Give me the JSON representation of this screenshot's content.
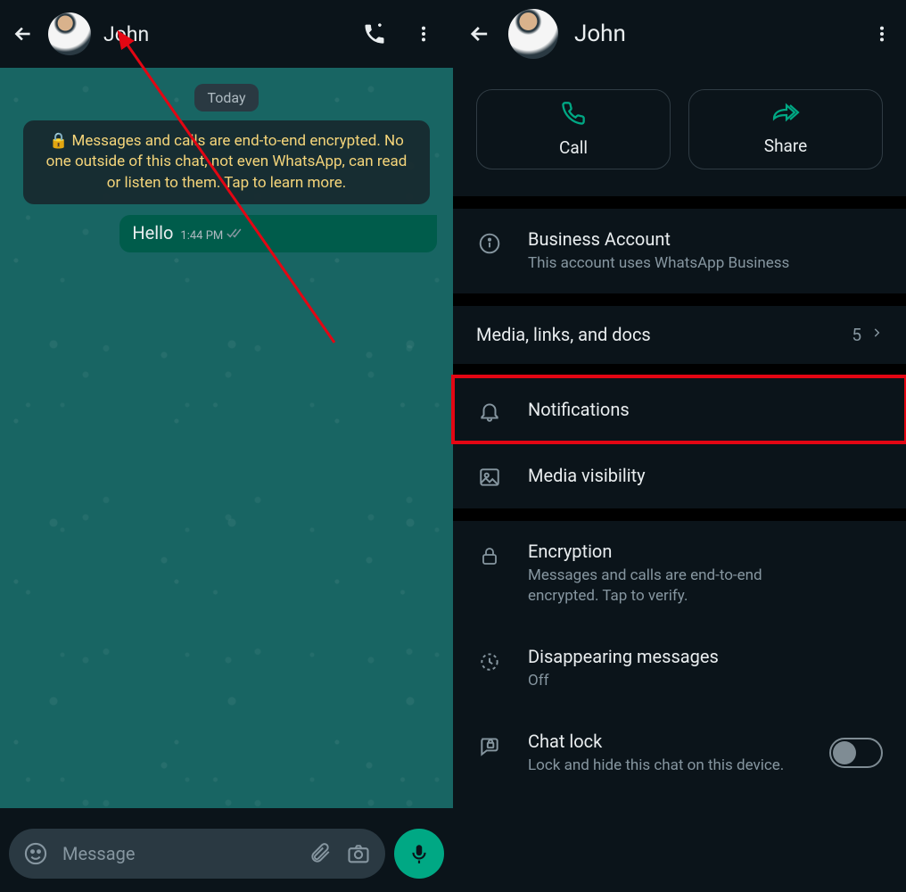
{
  "left": {
    "contact_name": "John",
    "date_label": "Today",
    "encryption_notice": "🔒 Messages and calls are end-to-end encrypted. No one outside of this chat, not even WhatsApp, can read or listen to them. Tap to learn more.",
    "message": {
      "text": "Hello",
      "time": "1:44 PM"
    },
    "input_placeholder": "Message"
  },
  "right": {
    "contact_name": "John",
    "call_label": "Call",
    "share_label": "Share",
    "business": {
      "title": "Business Account",
      "subtitle": "This account uses WhatsApp Business"
    },
    "media": {
      "title": "Media, links, and docs",
      "count": "5"
    },
    "notifications": {
      "title": "Notifications"
    },
    "media_visibility": {
      "title": "Media visibility"
    },
    "encryption": {
      "title": "Encryption",
      "subtitle": "Messages and calls are end-to-end encrypted. Tap to verify."
    },
    "disappearing": {
      "title": "Disappearing messages",
      "subtitle": "Off"
    },
    "chat_lock": {
      "title": "Chat lock",
      "subtitle": "Lock and hide this chat on this device."
    }
  }
}
